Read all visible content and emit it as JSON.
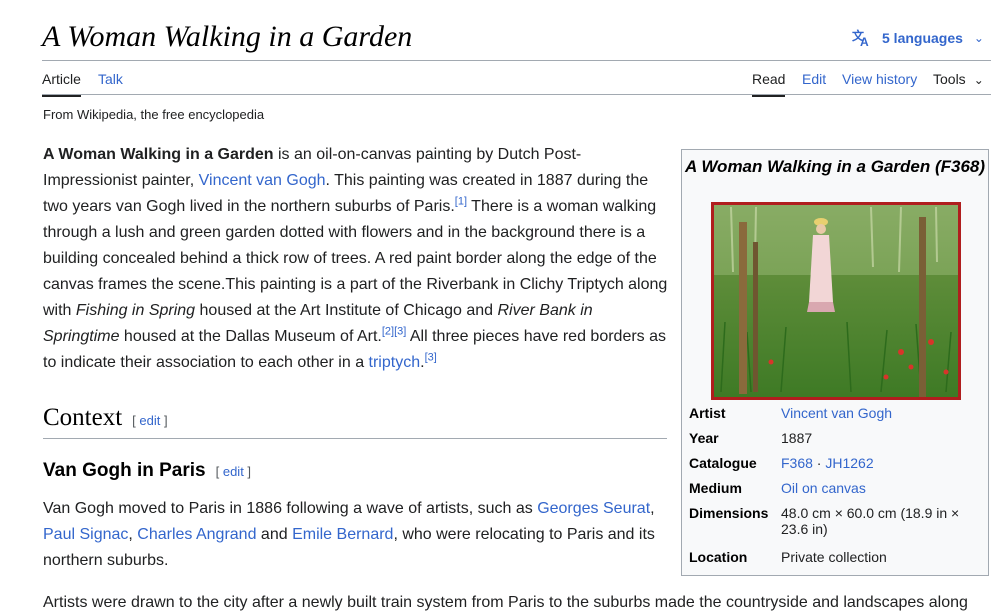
{
  "header": {
    "title": "A Woman Walking in a Garden",
    "languages_label": "5 languages",
    "languages_icon": "translate-icon"
  },
  "tabs": {
    "article": "Article",
    "talk": "Talk",
    "read": "Read",
    "edit": "Edit",
    "view_history": "View history",
    "tools": "Tools"
  },
  "tagline": "From Wikipedia, the free encyclopedia",
  "intro": {
    "p1_bold": "A Woman Walking in a Garden",
    "p1_a": " is an oil-on-canvas painting by Dutch Post-Impressionist painter, ",
    "p1_link_vvg": "Vincent van Gogh",
    "p1_b": ". This painting was created in 1887 during the two years van Gogh lived in the northern suburbs of Paris.",
    "ref1": "[1]",
    "p1_c": " There is a woman walking through a lush and green garden dotted with flowers and in the background there is a building concealed behind a thick row of trees. A red paint border along the edge of the canvas frames the scene.This painting is a part of the Riverbank in Clichy Triptych along with ",
    "p1_it1": "Fishing in Spring",
    "p1_d": " housed at the Art Institute of Chicago and ",
    "p1_it2": "River Bank in Springtime",
    "p1_e": " housed at the Dallas Museum of Art.",
    "ref2": "[2]",
    "ref3": "[3]",
    "p1_f": " All three pieces have red borders as to indicate their association to each other in a ",
    "p1_link_triptych": "triptych",
    "p1_g": ".",
    "ref3b": "[3]"
  },
  "context": {
    "heading": "Context",
    "edit_open": "[ ",
    "edit_label": "edit",
    "edit_close": " ]"
  },
  "vgparis": {
    "heading": "Van Gogh in Paris",
    "edit_label": "edit",
    "p_a": "Van Gogh moved to Paris in 1886 following a wave of artists, such as ",
    "link_seurat": "Georges Seurat",
    "sep1": ", ",
    "link_signac": "Paul Signac",
    "sep2": ", ",
    "link_angrand": "Charles Angrand",
    "and": " and ",
    "link_bernard": "Emile Bernard",
    "p_b": ", who were relocating to Paris and its northern suburbs."
  },
  "cut_paragraph": "Artists were drawn to the city after a newly built train system from Paris to the suburbs made the countryside and landscapes along",
  "infobox": {
    "title": "A Woman Walking in a Garden (F368)",
    "rows": {
      "artist_label": "Artist",
      "artist_value": "Vincent van Gogh",
      "year_label": "Year",
      "year_value": "1887",
      "catalogue_label": "Catalogue",
      "catalogue_f": "F368",
      "catalogue_sep": " · ",
      "catalogue_jh": "JH1262",
      "medium_label": "Medium",
      "medium_value": "Oil on canvas",
      "dimensions_label": "Dimensions",
      "dimensions_value": "48.0 cm × 60.0 cm (18.9 in × 23.6 in)",
      "location_label": "Location",
      "location_value": "Private collection"
    }
  },
  "colors": {
    "link": "#3366cc",
    "text": "#202122",
    "border": "#a2a9b1",
    "infobox_bg": "#f8f9fa",
    "painting_frame": "#b01e1e"
  }
}
